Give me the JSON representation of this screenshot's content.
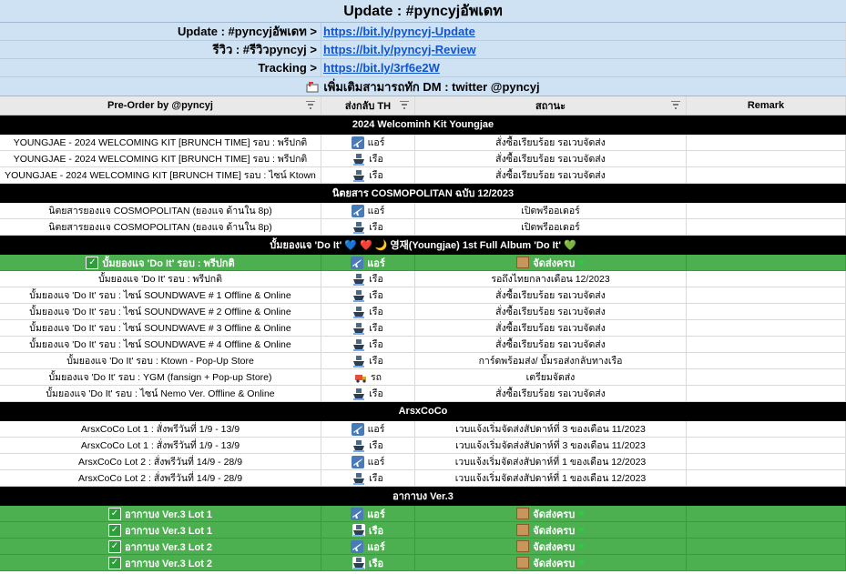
{
  "title": "Update : #pyncyjอัพเดท",
  "info": [
    {
      "label": "Update : #pyncyjอัพเดท >",
      "link": "https://bit.ly/pyncyj-Update"
    },
    {
      "label": "รีวิว : #รีวิวpyncyj >",
      "link": "https://bit.ly/pyncyj-Review"
    },
    {
      "label": "Tracking >",
      "link": "https://bit.ly/3rf6e2W"
    }
  ],
  "dm_text": "เพิ่มเติมสามารถทัก DM : twitter @pyncyj",
  "headers": [
    "Pre-Order by  @pyncyj",
    "ส่งกลับ TH",
    "สถานะ",
    "Remark"
  ],
  "sections": [
    {
      "title": "2024 Welcominh Kit Youngjae",
      "rows": [
        {
          "item": "YOUNGJAE - 2024 WELCOMING KIT [BRUNCH TIME] รอบ : พรีปกติ",
          "ship_icon": "plane",
          "ship": "แอร์",
          "status": "สั่งซื้อเรียบร้อย รอเวบจัดส่ง",
          "remark": ""
        },
        {
          "item": "YOUNGJAE - 2024 WELCOMING KIT [BRUNCH TIME] รอบ : พรีปกติ",
          "ship_icon": "ship",
          "ship": "เรือ",
          "status": "สั่งซื้อเรียบร้อย รอเวบจัดส่ง",
          "remark": ""
        },
        {
          "item": "YOUNGJAE - 2024 WELCOMING KIT [BRUNCH TIME] รอบ : ไซน์ Ktown",
          "ship_icon": "ship",
          "ship": "เรือ",
          "status": "สั่งซื้อเรียบร้อย รอเวบจัดส่ง",
          "remark": ""
        }
      ]
    },
    {
      "title": "นิตยสาร COSMOPOLITAN ฉบับ 12/2023",
      "rows": [
        {
          "item": "นิตยสารยองแจ COSMOPOLITAN (ยองแจ ด้านใน 8p)",
          "ship_icon": "plane",
          "ship": "แอร์",
          "status": "เปิดพรีออเดอร์",
          "remark": ""
        },
        {
          "item": "นิตยสารยองแจ COSMOPOLITAN (ยองแจ ด้านใน 8p)",
          "ship_icon": "ship",
          "ship": "เรือ",
          "status": "เปิดพรีออเดอร์",
          "remark": ""
        }
      ]
    },
    {
      "title": "บั้มยองแจ 'Do It' 💙 ❤️ 🌙 영재(Youngjae) 1st Full Album 'Do It' 💚",
      "rows": [
        {
          "green": true,
          "item": "บั้มยองแจ 'Do It' รอบ : พรีปกติ",
          "ship_icon": "plane",
          "ship": "แอร์",
          "status": "จัดส่งครบ",
          "remark": ""
        },
        {
          "item": "บั้มยองแจ 'Do It' รอบ : พรีปกติ",
          "ship_icon": "ship",
          "ship": "เรือ",
          "status": "รอถึงไทยกลางเดือน 12/2023",
          "remark": ""
        },
        {
          "item": "บั้มยองแจ 'Do It' รอบ : ไซน์ SOUNDWAVE # 1 Offline & Online",
          "ship_icon": "ship",
          "ship": "เรือ",
          "status": "สั่งซื้อเรียบร้อย รอเวบจัดส่ง",
          "remark": ""
        },
        {
          "item": "บั้มยองแจ 'Do It' รอบ : ไซน์ SOUNDWAVE # 2 Offline & Online",
          "ship_icon": "ship",
          "ship": "เรือ",
          "status": "สั่งซื้อเรียบร้อย รอเวบจัดส่ง",
          "remark": ""
        },
        {
          "item": "บั้มยองแจ 'Do It' รอบ : ไซน์ SOUNDWAVE # 3 Offline & Online",
          "ship_icon": "ship",
          "ship": "เรือ",
          "status": "สั่งซื้อเรียบร้อย รอเวบจัดส่ง",
          "remark": ""
        },
        {
          "item": "บั้มยองแจ 'Do It' รอบ : ไซน์ SOUNDWAVE # 4 Offline & Online",
          "ship_icon": "ship",
          "ship": "เรือ",
          "status": "สั่งซื้อเรียบร้อย รอเวบจัดส่ง",
          "remark": ""
        },
        {
          "item": "บั้มยองแจ 'Do It' รอบ : Ktown - Pop-Up Store",
          "ship_icon": "ship",
          "ship": "เรือ",
          "status": "การ์ดพร้อมส่ง/ บั้มรอส่งกลับทางเรือ",
          "remark": ""
        },
        {
          "item": "บั้มยองแจ 'Do It' รอบ : YGM (fansign + Pop-up Store)",
          "ship_icon": "truck",
          "ship": "รถ",
          "status": "เตรียมจัดส่ง",
          "remark": ""
        },
        {
          "item": "บั้มยองแจ 'Do It' รอบ : ไซน์ Nemo Ver. Offline & Online",
          "ship_icon": "ship",
          "ship": "เรือ",
          "status": "สั่งซื้อเรียบร้อย รอเวบจัดส่ง",
          "remark": ""
        }
      ]
    },
    {
      "title": "ArsxCoCo",
      "rows": [
        {
          "item": "ArsxCoCo Lot 1 : สั่งพรีวันที่ 1/9 - 13/9",
          "ship_icon": "plane",
          "ship": "แอร์",
          "status": "เวบแจ้งเริ่มจัดส่งสัปดาห์ที่ 3 ของเดือน 11/2023",
          "remark": ""
        },
        {
          "item": "ArsxCoCo Lot 1 : สั่งพรีวันที่ 1/9 - 13/9",
          "ship_icon": "ship",
          "ship": "เรือ",
          "status": "เวบแจ้งเริ่มจัดส่งสัปดาห์ที่ 3 ของเดือน 11/2023",
          "remark": ""
        },
        {
          "item": "ArsxCoCo Lot 2 : สั่งพรีวันที่ 14/9 - 28/9",
          "ship_icon": "plane",
          "ship": "แอร์",
          "status": "เวบแจ้งเริ่มจัดส่งสัปดาห์ที่ 1 ของเดือน 12/2023",
          "remark": ""
        },
        {
          "item": "ArsxCoCo Lot 2 : สั่งพรีวันที่ 14/9 - 28/9",
          "ship_icon": "ship",
          "ship": "เรือ",
          "status": "เวบแจ้งเริ่มจัดส่งสัปดาห์ที่ 1 ของเดือน 12/2023",
          "remark": ""
        }
      ]
    },
    {
      "title": "อากาบง Ver.3",
      "rows": [
        {
          "green": true,
          "item": "อากาบง Ver.3 Lot 1",
          "ship_icon": "plane",
          "ship": "แอร์",
          "status": "จัดส่งครบ",
          "remark": ""
        },
        {
          "green": true,
          "item": "อากาบง Ver.3 Lot 1",
          "ship_icon": "ship",
          "ship": "เรือ",
          "status": "จัดส่งครบ",
          "remark": ""
        },
        {
          "green": true,
          "item": "อากาบง Ver.3 Lot 2",
          "ship_icon": "plane",
          "ship": "แอร์",
          "status": "จัดส่งครบ",
          "remark": ""
        },
        {
          "green": true,
          "item": "อากาบง Ver.3 Lot 2",
          "ship_icon": "ship",
          "ship": "เรือ",
          "status": "จัดส่งครบ",
          "remark": ""
        }
      ]
    }
  ],
  "colors": {
    "header_bg": "#cfe2f3",
    "link": "#1155cc",
    "section_bg": "#000000",
    "done_bg": "#4caf50"
  }
}
